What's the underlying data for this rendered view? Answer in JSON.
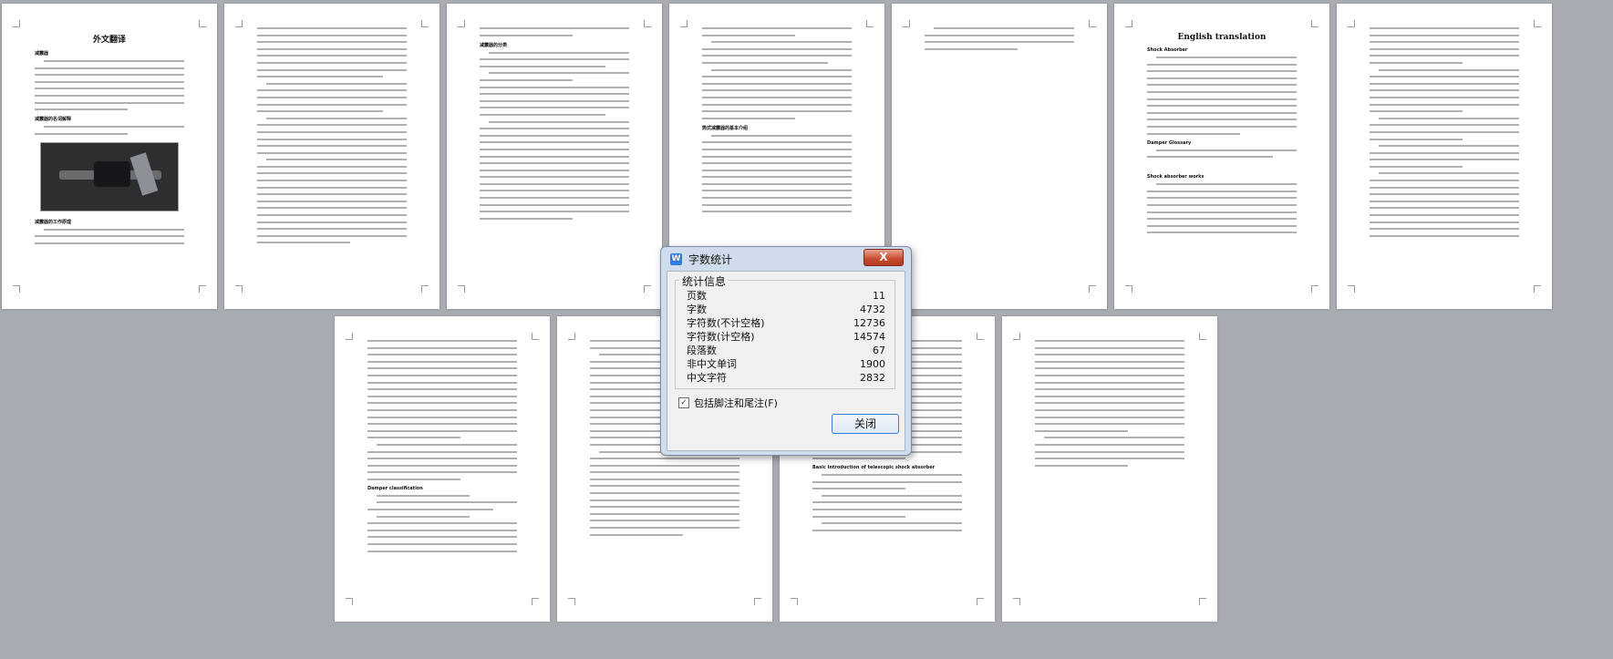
{
  "pages": [
    {
      "title": "外文翻译",
      "headings": [
        "减震器",
        "减震器的名词解释",
        "减震器的工作原理"
      ]
    },
    {
      "title": "",
      "headings": []
    },
    {
      "title": "",
      "headings": [
        "减震器的分类"
      ]
    },
    {
      "title": "",
      "headings": [
        "筒式减震器的基本介绍"
      ]
    },
    {
      "title": "",
      "headings": []
    },
    {
      "title": "English translation",
      "headings": [
        "Shock Absorber",
        "Damper Glossary",
        "Shock absorber works"
      ]
    },
    {
      "title": "",
      "headings": []
    },
    {
      "title": "",
      "headings": [
        "Damper classification"
      ]
    },
    {
      "title": "",
      "headings": []
    },
    {
      "title": "",
      "headings": [
        "Basic Introduction of telescopic shock absorber"
      ]
    },
    {
      "title": "",
      "headings": []
    }
  ],
  "dialog": {
    "title": "字数统计",
    "close_x": "X",
    "group_label": "统计信息",
    "stats": [
      {
        "label": "页数",
        "value": "11"
      },
      {
        "label": "字数",
        "value": "4732"
      },
      {
        "label": "字符数(不计空格)",
        "value": "12736"
      },
      {
        "label": "字符数(计空格)",
        "value": "14574"
      },
      {
        "label": "段落数",
        "value": "67"
      },
      {
        "label": "非中文单词",
        "value": "1900"
      },
      {
        "label": "中文字符",
        "value": "2832"
      }
    ],
    "checkbox_label": "包括脚注和尾注(F)",
    "checkbox_checked": true,
    "close_button": "关闭"
  }
}
